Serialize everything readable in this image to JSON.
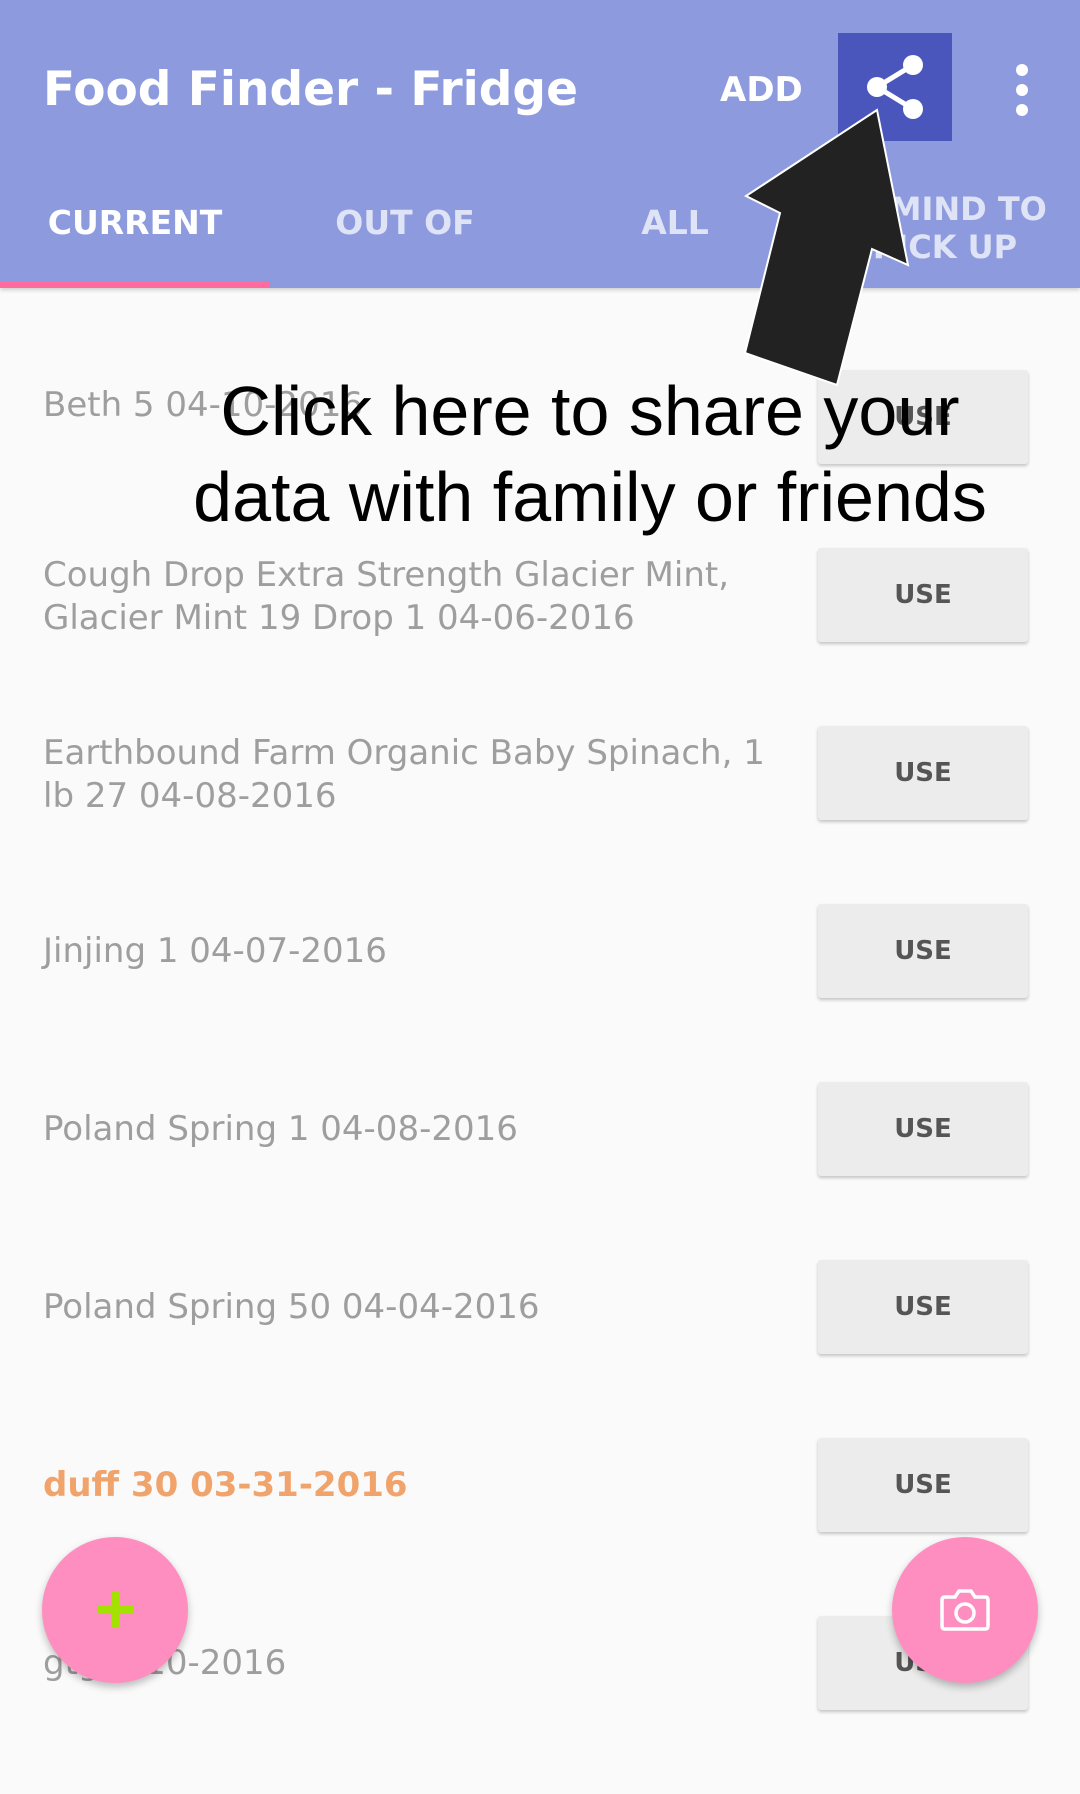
{
  "app_bar": {
    "title": "Food Finder - Fridge",
    "add_action": "ADD",
    "share_icon": "share-icon",
    "overflow_icon": "more-vert-icon"
  },
  "tabs": [
    {
      "label": "CURRENT",
      "active": true
    },
    {
      "label": "OUT OF",
      "active": false
    },
    {
      "label": "ALL",
      "active": false
    },
    {
      "label": "REMIND TO\nPICK UP",
      "active": false
    }
  ],
  "items": [
    {
      "name": "Beth",
      "qty": "5",
      "date": "04-10-2016",
      "text": "Beth 5  04-10-2016",
      "action": "USE"
    },
    {
      "name": "Cough Drop Extra Strength Glacier Mint, Glacier Mint 19 Drop",
      "qty": "1",
      "date": "04-06-2016",
      "text": "Cough Drop Extra Strength Glacier Mint, Glacier Mint 19 Drop 1  04-06-2016",
      "action": "USE"
    },
    {
      "name": "Earthbound Farm Organic Baby Spinach, 1 lb",
      "qty": "27",
      "date": "04-08-2016",
      "text": "Earthbound Farm Organic Baby Spinach, 1 lb 27 04-08-2016",
      "action": "USE"
    },
    {
      "name": "Jinjing",
      "qty": "1",
      "date": "04-07-2016",
      "text": "Jinjing 1  04-07-2016",
      "action": "USE"
    },
    {
      "name": "Poland Spring",
      "qty": "1",
      "date": "04-08-2016",
      "text": "Poland Spring 1  04-08-2016",
      "action": "USE"
    },
    {
      "name": "Poland Spring",
      "qty": "50",
      "date": "04-04-2016",
      "text": "Poland Spring 50  04-04-2016",
      "action": "USE"
    },
    {
      "name": "duff",
      "qty": "30",
      "date": "03-31-2016",
      "text": "duff 30  03-31-2016",
      "action": "USE",
      "expired": true
    },
    {
      "name": "gtg",
      "qty": "",
      "date": "04-10-2016",
      "text": "gtg 4-10-2016",
      "action": "USE"
    }
  ],
  "fab": {
    "add_icon": "plus-icon",
    "camera_icon": "camera-icon"
  },
  "annotation": {
    "text": "Click here to share your data with family or friends"
  },
  "colors": {
    "app_bar": "#8d9bde",
    "share_highlight": "#4a56bb",
    "tab_indicator": "#ff6b9e",
    "fab": "#ff8ec0",
    "expired_text": "#f0a46c",
    "item_text": "#9e9e9e"
  }
}
